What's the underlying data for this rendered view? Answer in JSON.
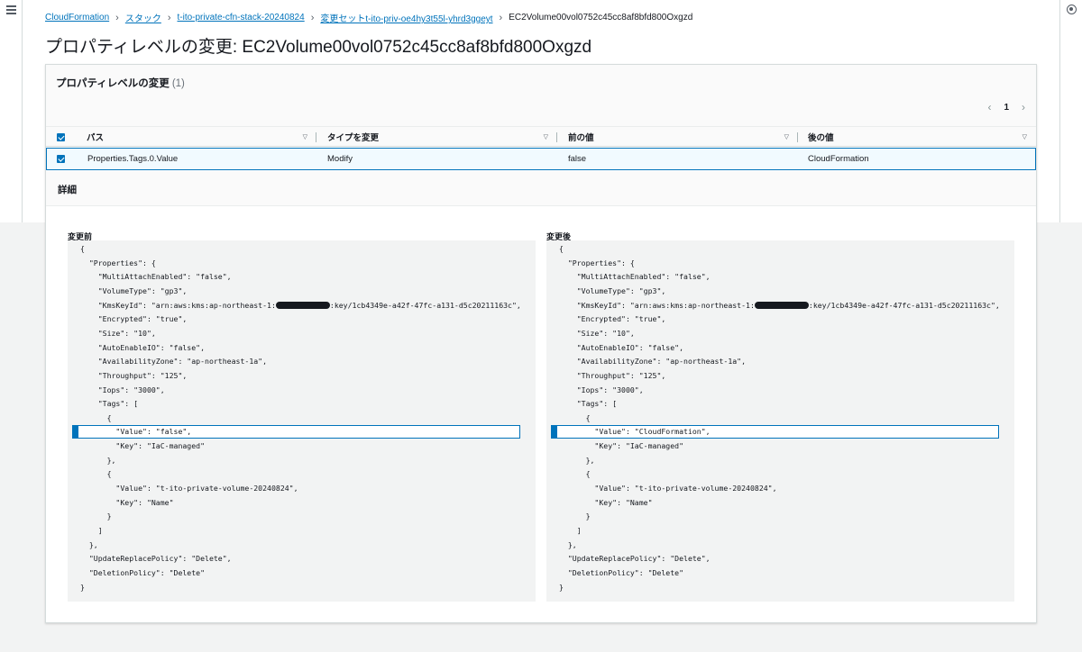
{
  "breadcrumb": {
    "items": [
      "CloudFormation",
      "スタック",
      "t-ito-private-cfn-stack-20240824",
      "変更セットt-ito-priv-oe4hy3t55l-yhrd3ggeyt"
    ],
    "current": "EC2Volume00vol0752c45cc8af8bfd800Oxgzd"
  },
  "page": {
    "title": "プロパティレベルの変更: EC2Volume00vol0752c45cc8af8bfd800Oxgzd"
  },
  "panel": {
    "title": "プロパティレベルの変更",
    "count": "(1)"
  },
  "pagination": {
    "current": "1"
  },
  "table": {
    "headers": [
      "パス",
      "タイプを変更",
      "前の値",
      "後の値"
    ],
    "row": [
      "Properties.Tags.0.Value",
      "Modify",
      "false",
      "CloudFormation"
    ]
  },
  "details": {
    "title": "詳細",
    "before_label": "変更前",
    "after_label": "変更後",
    "kms_prefix": "\"KmsKeyId\": \"arn:aws:kms:ap-northeast-1:",
    "kms_suffix": ":key/1cb4349e-a42f-47fc-a131-d5c20211163c\",",
    "before_lines": [
      "{",
      "  \"Properties\": {",
      "    \"MultiAttachEnabled\": \"false\",",
      "    \"VolumeType\": \"gp3\",",
      "",
      "    \"Encrypted\": \"true\",",
      "    \"Size\": \"10\",",
      "    \"AutoEnableIO\": \"false\",",
      "    \"AvailabilityZone\": \"ap-northeast-1a\",",
      "    \"Throughput\": \"125\",",
      "    \"Iops\": \"3000\",",
      "    \"Tags\": [",
      "      {",
      "        \"Value\": \"false\",",
      "        \"Key\": \"IaC-managed\"",
      "      },",
      "      {",
      "        \"Value\": \"t-ito-private-volume-20240824\",",
      "        \"Key\": \"Name\"",
      "      }",
      "    ]",
      "  },",
      "  \"UpdateReplacePolicy\": \"Delete\",",
      "  \"DeletionPolicy\": \"Delete\"",
      "}"
    ],
    "after_lines": [
      "{",
      "  \"Properties\": {",
      "    \"MultiAttachEnabled\": \"false\",",
      "    \"VolumeType\": \"gp3\",",
      "",
      "    \"Encrypted\": \"true\",",
      "    \"Size\": \"10\",",
      "    \"AutoEnableIO\": \"false\",",
      "    \"AvailabilityZone\": \"ap-northeast-1a\",",
      "    \"Throughput\": \"125\",",
      "    \"Iops\": \"3000\",",
      "    \"Tags\": [",
      "      {",
      "        \"Value\": \"CloudFormation\",",
      "        \"Key\": \"IaC-managed\"",
      "      },",
      "      {",
      "        \"Value\": \"t-ito-private-volume-20240824\",",
      "        \"Key\": \"Name\"",
      "      }",
      "    ]",
      "  },",
      "  \"UpdateReplacePolicy\": \"Delete\",",
      "  \"DeletionPolicy\": \"Delete\"",
      "}"
    ]
  },
  "icons": {
    "menu": "hamburger-icon",
    "settings": "settings-icon",
    "redaction": "redaction-mark"
  },
  "colors": {
    "accent": "#0073bb",
    "selected_row_bg": "#f1faff",
    "code_bg": "#f2f3f3"
  }
}
